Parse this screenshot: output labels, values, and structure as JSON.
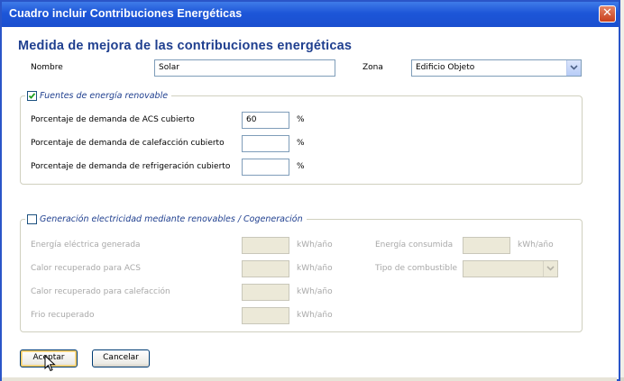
{
  "window": {
    "title": "Cuadro incluir Contribuciones Energéticas",
    "close_icon": "close-icon"
  },
  "heading": "Medida de mejora de las contribuciones energéticas",
  "nombre": {
    "label": "Nombre",
    "value": "Solar"
  },
  "zona": {
    "label": "Zona",
    "value": "Edificio Objeto"
  },
  "renovable": {
    "legend": "Fuentes de energía renovable",
    "checked": true,
    "rows": [
      {
        "label": "Porcentaje de demanda de ACS cubierto",
        "value": "60",
        "unit": "%"
      },
      {
        "label": "Porcentaje de demanda de calefacción cubierto",
        "value": "",
        "unit": "%"
      },
      {
        "label": "Porcentaje de demanda de refrigeración cubierto",
        "value": "",
        "unit": "%"
      }
    ]
  },
  "cogeneracion": {
    "legend": "Generación electricidad mediante renovables / Cogeneración",
    "checked": false,
    "left_rows": [
      {
        "label": "Energía eléctrica generada",
        "unit": "kWh/año"
      },
      {
        "label": "Calor recuperado para ACS",
        "unit": "kWh/año"
      },
      {
        "label": "Calor recuperado para calefacción",
        "unit": "kWh/año"
      },
      {
        "label": "Frio recuperado",
        "unit": "kWh/año"
      }
    ],
    "energia_consumida": {
      "label": "Energía consumida",
      "unit": "kWh/año"
    },
    "tipo_combustible": {
      "label": "Tipo de combustible"
    }
  },
  "buttons": {
    "accept": "Aceptar",
    "cancel": "Cancelar"
  }
}
